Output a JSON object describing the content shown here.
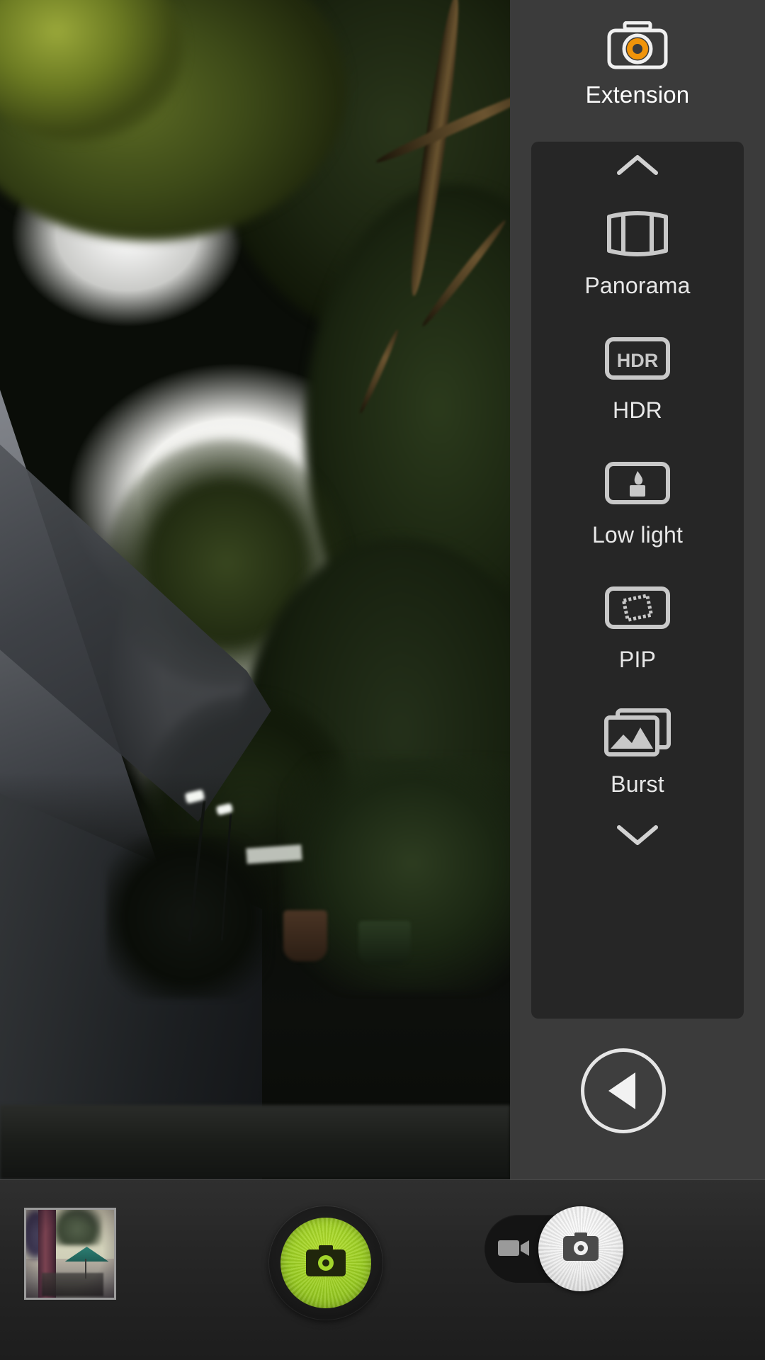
{
  "app": {
    "name": "Camera",
    "accent_green": "#a3d62b",
    "panel_bg": "#262626",
    "sidebar_bg": "#3b3b3b",
    "icon_gray": "#c8c8c8",
    "extension_orange": "#f0940a"
  },
  "sidebar": {
    "header": {
      "label": "Extension",
      "icon": "camera-extension-icon"
    },
    "scroll_up": {
      "icon": "chevron-up-icon"
    },
    "scroll_down": {
      "icon": "chevron-down-icon"
    },
    "modes": [
      {
        "label": "Panorama",
        "icon": "panorama-icon"
      },
      {
        "label": "HDR",
        "icon": "hdr-icon",
        "badge_text": "HDR"
      },
      {
        "label": "Low light",
        "icon": "low-light-candle-icon"
      },
      {
        "label": "PIP",
        "icon": "pip-frame-icon"
      },
      {
        "label": "Burst",
        "icon": "burst-stacked-photos-icon"
      }
    ],
    "back_button": {
      "label": "Back",
      "icon": "back-triangle-icon"
    }
  },
  "bottom_bar": {
    "thumbnail": {
      "label": "Last photo",
      "icon": "photo-thumbnail"
    },
    "shutter": {
      "label": "Capture photo",
      "icon": "camera-shutter-icon"
    },
    "capture_mode_toggle": {
      "video_option": {
        "label": "Video",
        "icon": "video-camera-icon"
      },
      "photo_option": {
        "label": "Photo",
        "icon": "camera-icon"
      },
      "selected": "photo"
    }
  },
  "preview": {
    "label": "Camera viewfinder",
    "scene": "Tree canopy and bright sky above a building roofline"
  }
}
